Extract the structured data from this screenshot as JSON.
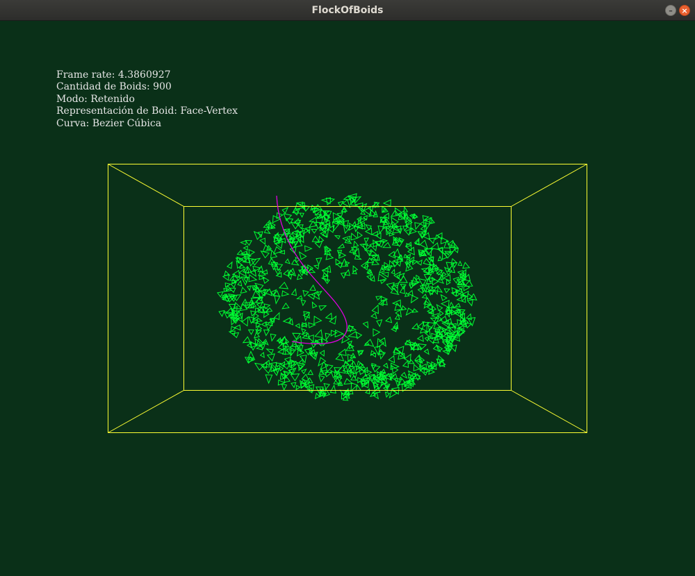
{
  "window": {
    "title": "FlockOfBoids",
    "minimize_symbol": "–",
    "close_symbol": "×"
  },
  "hud": {
    "frame_rate": "Frame rate: 4.3860927",
    "boid_count": "Cantidad de Boids: 900",
    "mode": "Modo: Retenido",
    "representation": "Representación de Boid: Face-Vertex",
    "curve": "Curva: Bezier Cúbica"
  },
  "scene": {
    "boid_count": 900,
    "colors": {
      "background": "#0a3018",
      "box": "#ffff33",
      "boids": "#00ff33",
      "curve": "#e000e0"
    }
  }
}
